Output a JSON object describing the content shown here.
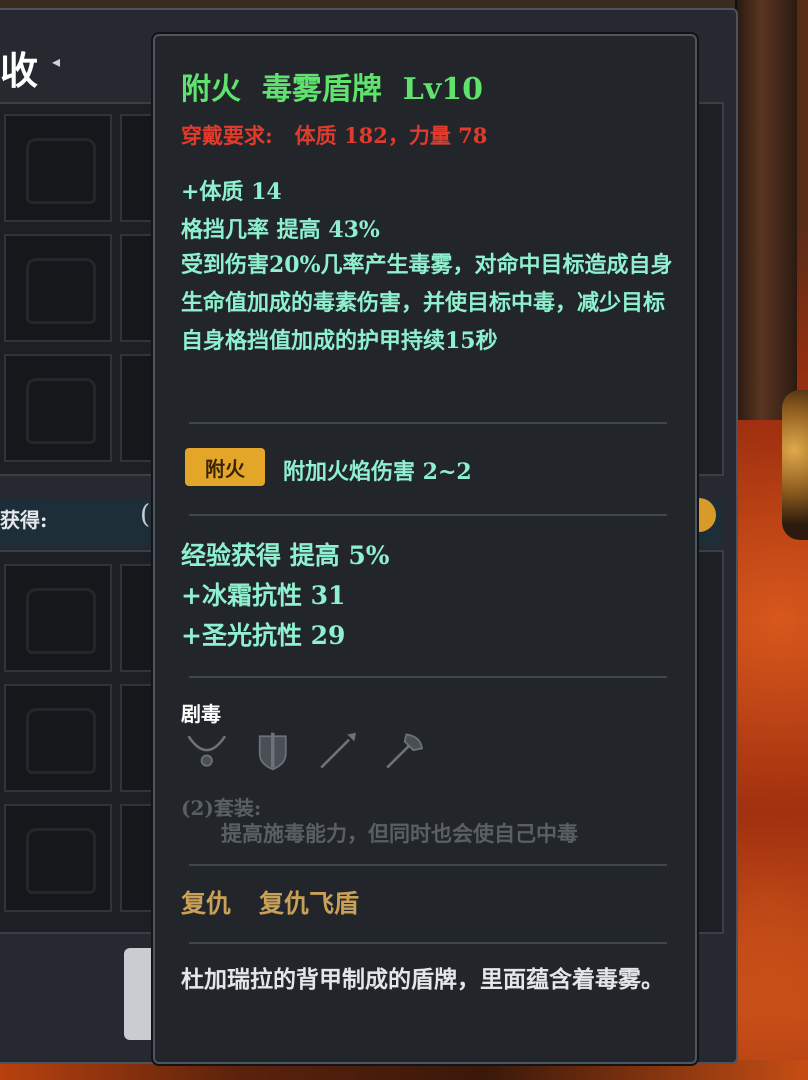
{
  "background_panel": {
    "title": "收",
    "gain_label": "获得:",
    "gain_value": "("
  },
  "tooltip": {
    "title": "附火  毒雾盾牌  Lv10",
    "requirement": "穿戴要求:   体质 182，力量 78",
    "stats": [
      "+体质 14",
      "格挡几率 提高 43%"
    ],
    "special_effect": "受到伤害20%几率产生毒雾，对命中目标造成自身生命值加成的毒素伤害，并使目标中毒，减少目标自身格挡值加成的护甲持续15秒",
    "enchant": {
      "badge": "附火",
      "text": "附加火焰伤害 2~2"
    },
    "bonus_stats": [
      "经验获得 提高 5%",
      "+冰霜抗性 31",
      "+圣光抗性 29"
    ],
    "set": {
      "name": "剧毒",
      "pieces": [
        "necklace-icon",
        "shield-icon",
        "spear-icon",
        "axe-icon"
      ],
      "count_label": "(2)套装:",
      "effect": "提高施毒能力，但同时也会使自己中毒"
    },
    "skills": [
      "复仇",
      "复仇飞盾"
    ],
    "flavor_text": "杜加瑞拉的背甲制成的盾牌，里面蕴含着毒雾。"
  },
  "colors": {
    "title_green": "#5fe36d",
    "requirement_red": "#e03b2c",
    "stat_cyan": "#8ff0cf",
    "badge_gold": "#e3a629",
    "skill_gold": "#c9a057",
    "inactive_gray": "#5a5f66"
  }
}
